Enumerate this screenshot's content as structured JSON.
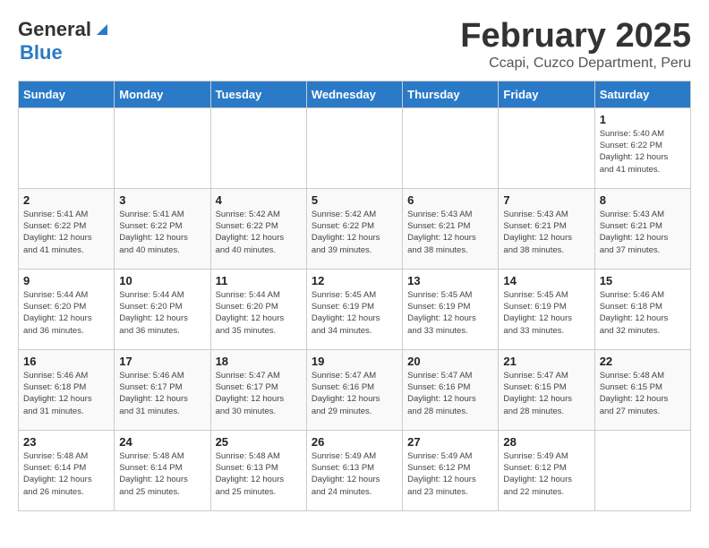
{
  "header": {
    "logo_general": "General",
    "logo_blue": "Blue",
    "title": "February 2025",
    "subtitle": "Ccapi, Cuzco Department, Peru"
  },
  "weekdays": [
    "Sunday",
    "Monday",
    "Tuesday",
    "Wednesday",
    "Thursday",
    "Friday",
    "Saturday"
  ],
  "weeks": [
    [
      {
        "day": "",
        "info": ""
      },
      {
        "day": "",
        "info": ""
      },
      {
        "day": "",
        "info": ""
      },
      {
        "day": "",
        "info": ""
      },
      {
        "day": "",
        "info": ""
      },
      {
        "day": "",
        "info": ""
      },
      {
        "day": "1",
        "info": "Sunrise: 5:40 AM\nSunset: 6:22 PM\nDaylight: 12 hours\nand 41 minutes."
      }
    ],
    [
      {
        "day": "2",
        "info": "Sunrise: 5:41 AM\nSunset: 6:22 PM\nDaylight: 12 hours\nand 41 minutes."
      },
      {
        "day": "3",
        "info": "Sunrise: 5:41 AM\nSunset: 6:22 PM\nDaylight: 12 hours\nand 40 minutes."
      },
      {
        "day": "4",
        "info": "Sunrise: 5:42 AM\nSunset: 6:22 PM\nDaylight: 12 hours\nand 40 minutes."
      },
      {
        "day": "5",
        "info": "Sunrise: 5:42 AM\nSunset: 6:22 PM\nDaylight: 12 hours\nand 39 minutes."
      },
      {
        "day": "6",
        "info": "Sunrise: 5:43 AM\nSunset: 6:21 PM\nDaylight: 12 hours\nand 38 minutes."
      },
      {
        "day": "7",
        "info": "Sunrise: 5:43 AM\nSunset: 6:21 PM\nDaylight: 12 hours\nand 38 minutes."
      },
      {
        "day": "8",
        "info": "Sunrise: 5:43 AM\nSunset: 6:21 PM\nDaylight: 12 hours\nand 37 minutes."
      }
    ],
    [
      {
        "day": "9",
        "info": "Sunrise: 5:44 AM\nSunset: 6:20 PM\nDaylight: 12 hours\nand 36 minutes."
      },
      {
        "day": "10",
        "info": "Sunrise: 5:44 AM\nSunset: 6:20 PM\nDaylight: 12 hours\nand 36 minutes."
      },
      {
        "day": "11",
        "info": "Sunrise: 5:44 AM\nSunset: 6:20 PM\nDaylight: 12 hours\nand 35 minutes."
      },
      {
        "day": "12",
        "info": "Sunrise: 5:45 AM\nSunset: 6:19 PM\nDaylight: 12 hours\nand 34 minutes."
      },
      {
        "day": "13",
        "info": "Sunrise: 5:45 AM\nSunset: 6:19 PM\nDaylight: 12 hours\nand 33 minutes."
      },
      {
        "day": "14",
        "info": "Sunrise: 5:45 AM\nSunset: 6:19 PM\nDaylight: 12 hours\nand 33 minutes."
      },
      {
        "day": "15",
        "info": "Sunrise: 5:46 AM\nSunset: 6:18 PM\nDaylight: 12 hours\nand 32 minutes."
      }
    ],
    [
      {
        "day": "16",
        "info": "Sunrise: 5:46 AM\nSunset: 6:18 PM\nDaylight: 12 hours\nand 31 minutes."
      },
      {
        "day": "17",
        "info": "Sunrise: 5:46 AM\nSunset: 6:17 PM\nDaylight: 12 hours\nand 31 minutes."
      },
      {
        "day": "18",
        "info": "Sunrise: 5:47 AM\nSunset: 6:17 PM\nDaylight: 12 hours\nand 30 minutes."
      },
      {
        "day": "19",
        "info": "Sunrise: 5:47 AM\nSunset: 6:16 PM\nDaylight: 12 hours\nand 29 minutes."
      },
      {
        "day": "20",
        "info": "Sunrise: 5:47 AM\nSunset: 6:16 PM\nDaylight: 12 hours\nand 28 minutes."
      },
      {
        "day": "21",
        "info": "Sunrise: 5:47 AM\nSunset: 6:15 PM\nDaylight: 12 hours\nand 28 minutes."
      },
      {
        "day": "22",
        "info": "Sunrise: 5:48 AM\nSunset: 6:15 PM\nDaylight: 12 hours\nand 27 minutes."
      }
    ],
    [
      {
        "day": "23",
        "info": "Sunrise: 5:48 AM\nSunset: 6:14 PM\nDaylight: 12 hours\nand 26 minutes."
      },
      {
        "day": "24",
        "info": "Sunrise: 5:48 AM\nSunset: 6:14 PM\nDaylight: 12 hours\nand 25 minutes."
      },
      {
        "day": "25",
        "info": "Sunrise: 5:48 AM\nSunset: 6:13 PM\nDaylight: 12 hours\nand 25 minutes."
      },
      {
        "day": "26",
        "info": "Sunrise: 5:49 AM\nSunset: 6:13 PM\nDaylight: 12 hours\nand 24 minutes."
      },
      {
        "day": "27",
        "info": "Sunrise: 5:49 AM\nSunset: 6:12 PM\nDaylight: 12 hours\nand 23 minutes."
      },
      {
        "day": "28",
        "info": "Sunrise: 5:49 AM\nSunset: 6:12 PM\nDaylight: 12 hours\nand 22 minutes."
      },
      {
        "day": "",
        "info": ""
      }
    ]
  ]
}
